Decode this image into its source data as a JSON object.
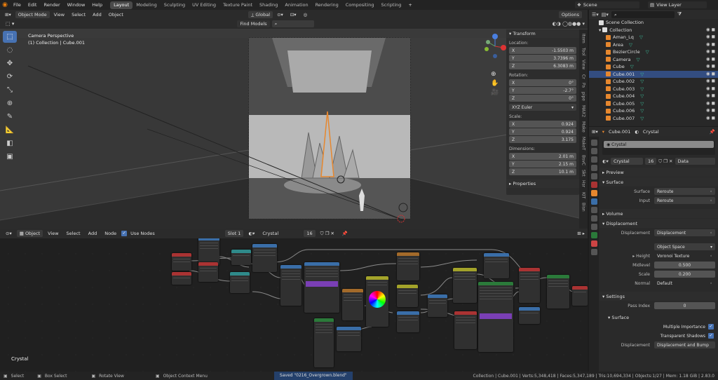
{
  "menu": {
    "items": [
      "File",
      "Edit",
      "Render",
      "Window",
      "Help"
    ]
  },
  "workspaces": [
    "Layout",
    "Modeling",
    "Sculpting",
    "UV Editing",
    "Texture Paint",
    "Shading",
    "Animation",
    "Rendering",
    "Compositing",
    "Scripting"
  ],
  "scene": {
    "label": "Scene",
    "view_layer": "View Layer"
  },
  "viewport": {
    "mode": "Object Mode",
    "menus": [
      "View",
      "Select",
      "Add",
      "Object"
    ],
    "orientation": "Global",
    "find_models": "Find Models",
    "options": "Options",
    "camera_label": "Camera Perspective",
    "collection_label": "(1) Collection | Cube.001"
  },
  "npanel": {
    "transform": "Transform",
    "location_label": "Location:",
    "location": [
      {
        "axis": "X",
        "value": "-1.5503 m"
      },
      {
        "axis": "Y",
        "value": "3.7396 m"
      },
      {
        "axis": "Z",
        "value": "6.3083 m"
      }
    ],
    "rotation_label": "Rotation:",
    "rotation": [
      {
        "axis": "X",
        "value": "0°"
      },
      {
        "axis": "Y",
        "value": "-2.7°"
      },
      {
        "axis": "Z",
        "value": "0°"
      }
    ],
    "rotation_mode": "XYZ Euler",
    "scale_label": "Scale:",
    "scale": [
      {
        "axis": "X",
        "value": "0.924"
      },
      {
        "axis": "Y",
        "value": "0.924"
      },
      {
        "axis": "Z",
        "value": "3.175"
      }
    ],
    "dimensions_label": "Dimensions:",
    "dimensions": [
      {
        "axis": "X",
        "value": "2.01 m"
      },
      {
        "axis": "Y",
        "value": "2.15 m"
      },
      {
        "axis": "Z",
        "value": "10.1 m"
      }
    ],
    "properties": "Properties",
    "side_tabs": [
      "Item",
      "Tool",
      "View",
      "Cr",
      "Pa",
      "pipe",
      "MAX2",
      "Make",
      "MakeT",
      "BsvC",
      "Skt",
      "Hsr",
      "KIT",
      "Bisn"
    ]
  },
  "node_editor": {
    "editor": "Object",
    "menus": [
      "View",
      "Select",
      "Add",
      "Node"
    ],
    "use_nodes": "Use Nodes",
    "slot": "Slot 1",
    "material": "Crystal",
    "users": "16",
    "label": "Crystal"
  },
  "outliner": {
    "scene_collection": "Scene Collection",
    "collection": "Collection",
    "items": [
      {
        "name": "Aman_Lq",
        "color": "#e6872e"
      },
      {
        "name": "Area",
        "color": "#e6872e"
      },
      {
        "name": "BezierCircle",
        "color": "#e6872e"
      },
      {
        "name": "Camera",
        "color": "#e6872e"
      },
      {
        "name": "Cube",
        "color": "#e6872e"
      },
      {
        "name": "Cube.001",
        "color": "#e6872e",
        "selected": true
      },
      {
        "name": "Cube.002",
        "color": "#e6872e"
      },
      {
        "name": "Cube.003",
        "color": "#e6872e"
      },
      {
        "name": "Cube.004",
        "color": "#e6872e"
      },
      {
        "name": "Cube.005",
        "color": "#e6872e"
      },
      {
        "name": "Cube.006",
        "color": "#e6872e"
      },
      {
        "name": "Cube.007",
        "color": "#e6872e"
      }
    ]
  },
  "properties": {
    "object": "Cube.001",
    "material": "Crystal",
    "slot_item": "Crystal",
    "mat_name": "Crystal",
    "mat_users": "16",
    "data": "Data",
    "sections": {
      "preview": "Preview",
      "surface": "Surface",
      "volume": "Volume",
      "displacement": "Displacement",
      "settings": "Settings",
      "surface_sub": "Surface"
    },
    "surface_rows": [
      {
        "label": "Surface",
        "value": "Reroute"
      },
      {
        "label": "Input",
        "value": "Reroute"
      }
    ],
    "displacement_rows": [
      {
        "label": "Displacement",
        "value": "Displacement"
      },
      {
        "label": "",
        "value": "Object Space"
      },
      {
        "label": "Height",
        "value": "Voronoi Texture"
      },
      {
        "label": "Midlevel",
        "value": "0.500"
      },
      {
        "label": "Scale",
        "value": "0.200"
      },
      {
        "label": "Normal",
        "value": "Default"
      }
    ],
    "pass_index_label": "Pass Index",
    "pass_index": "0",
    "multiple_importance": "Multiple Importance",
    "transparent_shadows": "Transparent Shadows",
    "displacement_method_label": "Displacement",
    "displacement_method": "Displacement and Bump"
  },
  "status": {
    "select": "Select",
    "box_select": "Box Select",
    "rotate_view": "Rotate View",
    "context_menu": "Object Context Menu",
    "saved": "Saved \"0216_Overgrown.blend\"",
    "stats": "Collection | Cube.001 | Verts:5,348,418 | Faces:5,347,189 | Tris:10,694,334 | Objects:1/27 | Mem: 1.18 GiB | 2.83.0"
  },
  "colors": {
    "accent": "#4772b3",
    "selection": "#e6872e",
    "header": "#2b2b2b"
  }
}
